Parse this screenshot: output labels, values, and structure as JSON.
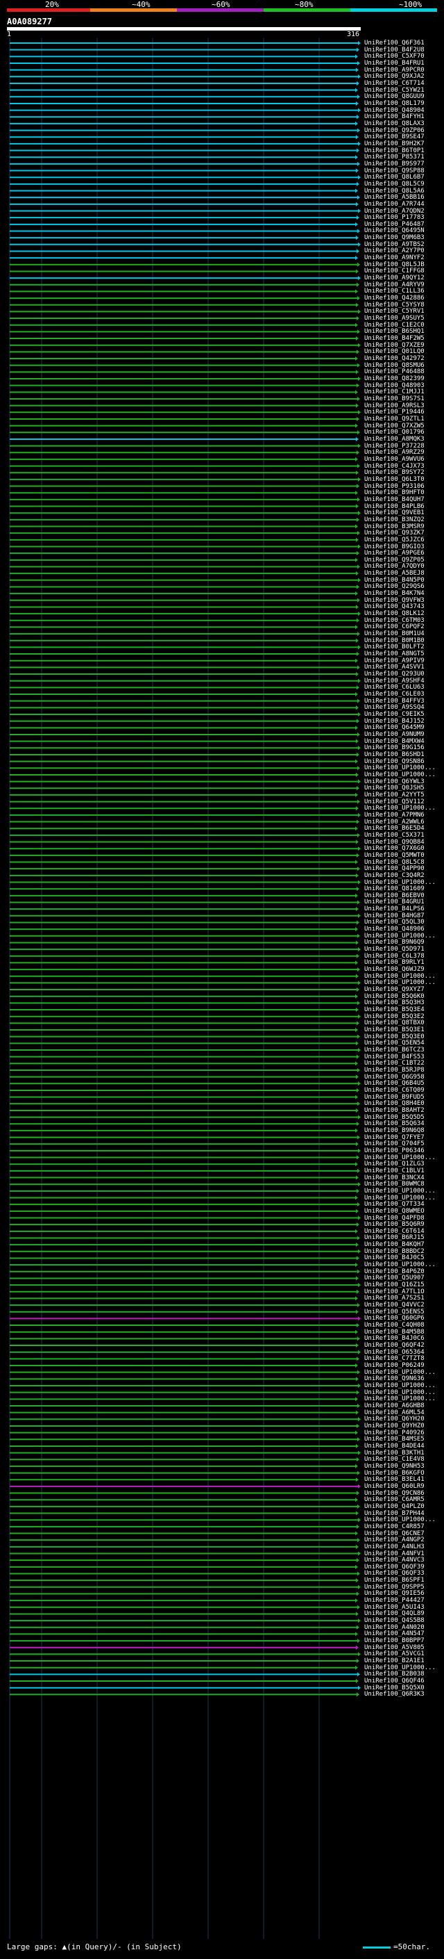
{
  "query": {
    "id": "A0A089277",
    "start": "1",
    "end": "316"
  },
  "legend": {
    "marks": [
      "20%",
      "~40%",
      "~60%",
      "~80%",
      "~100%"
    ],
    "colors": [
      "#e02020",
      "#f08020",
      "#a020c0",
      "#20c020",
      "#00d0e0"
    ]
  },
  "footer": {
    "left": "Large gaps: ▲(in Query)/- (in Subject)",
    "right": "=50char."
  },
  "hits": [
    {
      "name": "UniRef100_Q6F361",
      "c": "cyan"
    },
    {
      "name": "UniRef100_B4F2U8",
      "c": "cyan"
    },
    {
      "name": "UniRef100_C5XF70",
      "c": "cyan"
    },
    {
      "name": "UniRef100_B4FRU1",
      "c": "cyan"
    },
    {
      "name": "UniRef100_A9PCR0",
      "c": "cyan"
    },
    {
      "name": "UniRef100_Q9XJA2",
      "c": "cyan"
    },
    {
      "name": "UniRef100_C6T714",
      "c": "cyan"
    },
    {
      "name": "UniRef100_C5YW21",
      "c": "cyan"
    },
    {
      "name": "UniRef100_Q8GUU9",
      "c": "cyan"
    },
    {
      "name": "UniRef100_Q8L179",
      "c": "cyan"
    },
    {
      "name": "UniRef100_Q48904",
      "c": "cyan"
    },
    {
      "name": "UniRef100_B4FYH1",
      "c": "cyan"
    },
    {
      "name": "UniRef100_Q8LAX3",
      "c": "cyan"
    },
    {
      "name": "UniRef100_Q9ZP06",
      "c": "cyan"
    },
    {
      "name": "UniRef100_B9SE47",
      "c": "cyan"
    },
    {
      "name": "UniRef100_B9H2K7",
      "c": "cyan"
    },
    {
      "name": "UniRef100_B6T0P1",
      "c": "cyan"
    },
    {
      "name": "UniRef100_P85371",
      "c": "cyan"
    },
    {
      "name": "UniRef100_B9S977",
      "c": "cyan"
    },
    {
      "name": "UniRef100_Q9SP88",
      "c": "cyan"
    },
    {
      "name": "UniRef100_Q8L6B7",
      "c": "cyan"
    },
    {
      "name": "UniRef100_Q8L5C9",
      "c": "cyan"
    },
    {
      "name": "UniRef100_Q8L5A6",
      "c": "cyan"
    },
    {
      "name": "UniRef100_A5BB16",
      "c": "cyan"
    },
    {
      "name": "UniRef100_A7R744",
      "c": "cyan"
    },
    {
      "name": "UniRef100_A7QDN2",
      "c": "cyan"
    },
    {
      "name": "UniRef100_P17783",
      "c": "cyan"
    },
    {
      "name": "UniRef100_P46487",
      "c": "cyan"
    },
    {
      "name": "UniRef100_Q6495N",
      "c": "cyan"
    },
    {
      "name": "UniRef100_Q9M6B3",
      "c": "cyan"
    },
    {
      "name": "UniRef100_A9TBS2",
      "c": "cyan"
    },
    {
      "name": "UniRef100_A2Y7P0",
      "c": "cyan"
    },
    {
      "name": "UniRef100_A9NYF2",
      "c": "cyan"
    },
    {
      "name": "UniRef100_Q8L5JB",
      "c": "green"
    },
    {
      "name": "UniRef100_C1FFG8",
      "c": "green"
    },
    {
      "name": "UniRef100_A9QY12",
      "c": "cyan"
    },
    {
      "name": "UniRef100_A4RYV9",
      "c": "green"
    },
    {
      "name": "UniRef100_C1LL36",
      "c": "green"
    },
    {
      "name": "UniRef100_Q42886",
      "c": "green"
    },
    {
      "name": "UniRef100_C5YSY8",
      "c": "green"
    },
    {
      "name": "UniRef100_C5YRV1",
      "c": "green"
    },
    {
      "name": "UniRef100_A9SUY5",
      "c": "green"
    },
    {
      "name": "UniRef100_C1E2C0",
      "c": "green"
    },
    {
      "name": "UniRef100_B6SHQ1",
      "c": "green"
    },
    {
      "name": "UniRef100_B4F2W5",
      "c": "green"
    },
    {
      "name": "UniRef100_Q7XZE9",
      "c": "green"
    },
    {
      "name": "UniRef100_Q01LQ0",
      "c": "green"
    },
    {
      "name": "UniRef100_Q42972",
      "c": "green"
    },
    {
      "name": "UniRef100_Q8SMU6",
      "c": "green"
    },
    {
      "name": "UniRef100_P46488",
      "c": "green"
    },
    {
      "name": "UniRef100_Q82399",
      "c": "green"
    },
    {
      "name": "UniRef100_Q48903",
      "c": "green"
    },
    {
      "name": "UniRef100_C1MJJ1",
      "c": "green"
    },
    {
      "name": "UniRef100_B9S7S1",
      "c": "green"
    },
    {
      "name": "UniRef100_A9RSL3",
      "c": "green"
    },
    {
      "name": "UniRef100_P19446",
      "c": "green"
    },
    {
      "name": "UniRef100_Q9ZTL1",
      "c": "green"
    },
    {
      "name": "UniRef100_Q7XZW5",
      "c": "green"
    },
    {
      "name": "UniRef100_Q01796",
      "c": "green"
    },
    {
      "name": "UniRef100_A8MQK3",
      "c": "cyan"
    },
    {
      "name": "UniRef100_P37228",
      "c": "green"
    },
    {
      "name": "UniRef100_A9RZ29",
      "c": "green"
    },
    {
      "name": "UniRef100_A9WVU6",
      "c": "green"
    },
    {
      "name": "UniRef100_C4JX73",
      "c": "green"
    },
    {
      "name": "UniRef100_B9SY72",
      "c": "green"
    },
    {
      "name": "UniRef100_Q6L3T0",
      "c": "green"
    },
    {
      "name": "UniRef100_P93106",
      "c": "green"
    },
    {
      "name": "UniRef100_B9HFT0",
      "c": "green"
    },
    {
      "name": "UniRef100_B4QUH7",
      "c": "green"
    },
    {
      "name": "UniRef100_B4PLB6",
      "c": "green"
    },
    {
      "name": "UniRef100_Q9VEB1",
      "c": "green"
    },
    {
      "name": "UniRef100_B3NZQ2",
      "c": "green"
    },
    {
      "name": "UniRef100_B3MSR9",
      "c": "green"
    },
    {
      "name": "UniRef100_Q93ZK7",
      "c": "green"
    },
    {
      "name": "UniRef100_Q5JZC6",
      "c": "green"
    },
    {
      "name": "UniRef100_B9GIO3",
      "c": "green"
    },
    {
      "name": "UniRef100_A9PGE6",
      "c": "green"
    },
    {
      "name": "UniRef100_Q9ZP05",
      "c": "green"
    },
    {
      "name": "UniRef100_A7QDY0",
      "c": "green"
    },
    {
      "name": "UniRef100_A5BEJ8",
      "c": "green"
    },
    {
      "name": "UniRef100_B4N5P0",
      "c": "green"
    },
    {
      "name": "UniRef100_Q29QS6",
      "c": "green"
    },
    {
      "name": "UniRef100_B4K7N4",
      "c": "green"
    },
    {
      "name": "UniRef100_Q9VFW3",
      "c": "green"
    },
    {
      "name": "UniRef100_Q43743",
      "c": "green"
    },
    {
      "name": "UniRef100_Q8LK12",
      "c": "green"
    },
    {
      "name": "UniRef100_C6TM03",
      "c": "green"
    },
    {
      "name": "UniRef100_C6PQF2",
      "c": "green"
    },
    {
      "name": "UniRef100_B0M1U4",
      "c": "green"
    },
    {
      "name": "UniRef100_B0M1B0",
      "c": "green"
    },
    {
      "name": "UniRef100_B0LFT2",
      "c": "green"
    },
    {
      "name": "UniRef100_A8NGT5",
      "c": "green"
    },
    {
      "name": "UniRef100_A9PIV9",
      "c": "green"
    },
    {
      "name": "UniRef100_A4SVV1",
      "c": "green"
    },
    {
      "name": "UniRef100_Q293U0",
      "c": "green"
    },
    {
      "name": "UniRef100_A9SHF4",
      "c": "green"
    },
    {
      "name": "UniRef100_C6LU63",
      "c": "green"
    },
    {
      "name": "UniRef100_C6LE03",
      "c": "green"
    },
    {
      "name": "UniRef100_B4FFV3",
      "c": "green"
    },
    {
      "name": "UniRef100_A9SSQ4",
      "c": "green"
    },
    {
      "name": "UniRef100_C9EIK5",
      "c": "green"
    },
    {
      "name": "UniRef100_B4J152",
      "c": "green"
    },
    {
      "name": "UniRef100_Q645M9",
      "c": "green"
    },
    {
      "name": "UniRef100_A9NUM9",
      "c": "green"
    },
    {
      "name": "UniRef100_B4MXW4",
      "c": "green"
    },
    {
      "name": "UniRef100_B9G156",
      "c": "green"
    },
    {
      "name": "UniRef100_B6SHD1",
      "c": "green"
    },
    {
      "name": "UniRef100_Q9SN86",
      "c": "green"
    },
    {
      "name": "UniRef100_UP1000...",
      "c": "green"
    },
    {
      "name": "UniRef100_UP1000...",
      "c": "green"
    },
    {
      "name": "UniRef100_Q6YWL3",
      "c": "green"
    },
    {
      "name": "UniRef100_Q0JSH5",
      "c": "green"
    },
    {
      "name": "UniRef100_A2YYT5",
      "c": "green"
    },
    {
      "name": "UniRef100_Q5V112",
      "c": "green"
    },
    {
      "name": "UniRef100_UP1000...",
      "c": "green"
    },
    {
      "name": "UniRef100_A7PMN6",
      "c": "green"
    },
    {
      "name": "UniRef100_A2WWL6",
      "c": "green"
    },
    {
      "name": "UniRef100_B6E5D4",
      "c": "green"
    },
    {
      "name": "UniRef100_C5X371",
      "c": "green"
    },
    {
      "name": "UniRef100_Q9QB84",
      "c": "green"
    },
    {
      "name": "UniRef100_Q7X6G0",
      "c": "green"
    },
    {
      "name": "UniRef100_Q5MWT0",
      "c": "green"
    },
    {
      "name": "UniRef100_Q8L5C8",
      "c": "green"
    },
    {
      "name": "UniRef100_Q4PP90",
      "c": "green"
    },
    {
      "name": "UniRef100_C3Q4R2",
      "c": "green"
    },
    {
      "name": "UniRef100_UP1000...",
      "c": "green"
    },
    {
      "name": "UniRef100_Q81609",
      "c": "green"
    },
    {
      "name": "UniRef100_B6EBV0",
      "c": "green"
    },
    {
      "name": "UniRef100_B4GRU1",
      "c": "green"
    },
    {
      "name": "UniRef100_B4LPS6",
      "c": "green"
    },
    {
      "name": "UniRef100_B4HG87",
      "c": "green"
    },
    {
      "name": "UniRef100_Q5QL30",
      "c": "green"
    },
    {
      "name": "UniRef100_Q48906",
      "c": "green"
    },
    {
      "name": "UniRef100_UP1000...",
      "c": "green"
    },
    {
      "name": "UniRef100_B9N6Q9",
      "c": "green"
    },
    {
      "name": "UniRef100_Q5D971",
      "c": "green"
    },
    {
      "name": "UniRef100_C6L378",
      "c": "green"
    },
    {
      "name": "UniRef100_B9RLY1",
      "c": "green"
    },
    {
      "name": "UniRef100_Q6WJZ9",
      "c": "green"
    },
    {
      "name": "UniRef100_UP1000...",
      "c": "green"
    },
    {
      "name": "UniRef100_UP1000...",
      "c": "green"
    },
    {
      "name": "UniRef100_Q9XYZ7",
      "c": "green"
    },
    {
      "name": "UniRef100_B5Q6K0",
      "c": "green"
    },
    {
      "name": "UniRef100_B5Q3H3",
      "c": "green"
    },
    {
      "name": "UniRef100_B5Q3E4",
      "c": "green"
    },
    {
      "name": "UniRef100_B5Q3E2",
      "c": "green"
    },
    {
      "name": "UniRef100_Q8TBX0",
      "c": "green"
    },
    {
      "name": "UniRef100_B5Q3E1",
      "c": "green"
    },
    {
      "name": "UniRef100_B5Q3E0",
      "c": "green"
    },
    {
      "name": "UniRef100_Q5EN54",
      "c": "green"
    },
    {
      "name": "UniRef100_B6TCZ3",
      "c": "green"
    },
    {
      "name": "UniRef100_B4FS53",
      "c": "green"
    },
    {
      "name": "UniRef100_C1BT22",
      "c": "green"
    },
    {
      "name": "UniRef100_B5RJP8",
      "c": "green"
    },
    {
      "name": "UniRef100_Q6G958",
      "c": "green"
    },
    {
      "name": "UniRef100_Q6B4U5",
      "c": "green"
    },
    {
      "name": "UniRef100_C6TQ09",
      "c": "green"
    },
    {
      "name": "UniRef100_B9FUD5",
      "c": "green"
    },
    {
      "name": "UniRef100_Q8H4E0",
      "c": "green"
    },
    {
      "name": "UniRef100_B8AHT2",
      "c": "green"
    },
    {
      "name": "UniRef100_B5Q5D5",
      "c": "green"
    },
    {
      "name": "UniRef100_B5Q634",
      "c": "green"
    },
    {
      "name": "UniRef100_B9N6Q8",
      "c": "green"
    },
    {
      "name": "UniRef100_Q7FYE7",
      "c": "green"
    },
    {
      "name": "UniRef100_Q704F5",
      "c": "green"
    },
    {
      "name": "UniRef100_P06346",
      "c": "green"
    },
    {
      "name": "UniRef100_UP1000...",
      "c": "green"
    },
    {
      "name": "UniRef100_Q1ZLG3",
      "c": "green"
    },
    {
      "name": "UniRef100_C1BLV1",
      "c": "green"
    },
    {
      "name": "UniRef100_B3NCX4",
      "c": "green"
    },
    {
      "name": "UniRef100_B0WMC8",
      "c": "green"
    },
    {
      "name": "UniRef100_UP1000...",
      "c": "green"
    },
    {
      "name": "UniRef100_UP1000...",
      "c": "green"
    },
    {
      "name": "UniRef100_Q7T334",
      "c": "green"
    },
    {
      "name": "UniRef100_Q8WMEO",
      "c": "green"
    },
    {
      "name": "UniRef100_Q4PFD8",
      "c": "green"
    },
    {
      "name": "UniRef100_B5Q6R9",
      "c": "green"
    },
    {
      "name": "UniRef100_C6T614",
      "c": "green"
    },
    {
      "name": "UniRef100_B6RJ15",
      "c": "green"
    },
    {
      "name": "UniRef100_B4KQH7",
      "c": "green"
    },
    {
      "name": "UniRef100_B8BDC2",
      "c": "green"
    },
    {
      "name": "UniRef100_B4J0C5",
      "c": "green"
    },
    {
      "name": "UniRef100_UP1000...",
      "c": "green"
    },
    {
      "name": "UniRef100_B4P6Z0",
      "c": "green"
    },
    {
      "name": "UniRef100_Q5U907",
      "c": "green"
    },
    {
      "name": "UniRef100_Q16Z15",
      "c": "green"
    },
    {
      "name": "UniRef100_A7TL1O",
      "c": "green"
    },
    {
      "name": "UniRef100_A7S2S1",
      "c": "green"
    },
    {
      "name": "UniRef100_Q4VVC2",
      "c": "green"
    },
    {
      "name": "UniRef100_Q5ENS5",
      "c": "green"
    },
    {
      "name": "UniRef100_Q60GP6",
      "c": "magenta"
    },
    {
      "name": "UniRef100_C4QH08",
      "c": "green"
    },
    {
      "name": "UniRef100_B4M5B8",
      "c": "green"
    },
    {
      "name": "UniRef100_B4J0C6",
      "c": "green"
    },
    {
      "name": "UniRef100_Q6QF42",
      "c": "green"
    },
    {
      "name": "UniRef100_O65364",
      "c": "green"
    },
    {
      "name": "UniRef100_C7TZT8",
      "c": "green"
    },
    {
      "name": "UniRef100_P06249",
      "c": "green"
    },
    {
      "name": "UniRef100_UP1000...",
      "c": "green"
    },
    {
      "name": "UniRef100_Q9N636",
      "c": "green"
    },
    {
      "name": "UniRef100_UP1000...",
      "c": "green"
    },
    {
      "name": "UniRef100_UP1000...",
      "c": "green"
    },
    {
      "name": "UniRef100_UP1000...",
      "c": "green"
    },
    {
      "name": "UniRef100_A6GHB8",
      "c": "green"
    },
    {
      "name": "UniRef100_A6ML54",
      "c": "green"
    },
    {
      "name": "UniRef100_Q6YH20",
      "c": "green"
    },
    {
      "name": "UniRef100_Q9YHZ0",
      "c": "green"
    },
    {
      "name": "UniRef100_P40926",
      "c": "green"
    },
    {
      "name": "UniRef100_B4MSE5",
      "c": "green"
    },
    {
      "name": "UniRef100_B4DE44",
      "c": "green"
    },
    {
      "name": "UniRef100_B3KTH1",
      "c": "green"
    },
    {
      "name": "UniRef100_C1E4V8",
      "c": "green"
    },
    {
      "name": "UniRef100_Q9NH53",
      "c": "green"
    },
    {
      "name": "UniRef100_B6KGFO",
      "c": "green"
    },
    {
      "name": "UniRef100_B3EL41",
      "c": "green"
    },
    {
      "name": "UniRef100_Q60LR9",
      "c": "magenta"
    },
    {
      "name": "UniRef100_Q9CN86",
      "c": "green"
    },
    {
      "name": "UniRef100_C6AMR5",
      "c": "green"
    },
    {
      "name": "UniRef100_Q4PLZ0",
      "c": "green"
    },
    {
      "name": "UniRef100_B7PH44",
      "c": "green"
    },
    {
      "name": "UniRef100_UP1000...",
      "c": "green"
    },
    {
      "name": "UniRef100_C4R857",
      "c": "green"
    },
    {
      "name": "UniRef100_Q6CNE7",
      "c": "green"
    },
    {
      "name": "UniRef100_A4NGP2",
      "c": "green"
    },
    {
      "name": "UniRef100_A4NLH3",
      "c": "green"
    },
    {
      "name": "UniRef100_A4NFV1",
      "c": "green"
    },
    {
      "name": "UniRef100_A4NVC3",
      "c": "green"
    },
    {
      "name": "UniRef100_Q6QF39",
      "c": "green"
    },
    {
      "name": "UniRef100_Q6QF33",
      "c": "green"
    },
    {
      "name": "UniRef100_B6SPF1",
      "c": "green"
    },
    {
      "name": "UniRef100_Q9SPP5",
      "c": "green"
    },
    {
      "name": "UniRef100_Q9IE56",
      "c": "green"
    },
    {
      "name": "UniRef100_P44427",
      "c": "green"
    },
    {
      "name": "UniRef100_A5UI43",
      "c": "green"
    },
    {
      "name": "UniRef100_Q4QL89",
      "c": "green"
    },
    {
      "name": "UniRef100_Q4S5B8",
      "c": "green"
    },
    {
      "name": "UniRef100_A4N020",
      "c": "green"
    },
    {
      "name": "UniRef100_A4N547",
      "c": "green"
    },
    {
      "name": "UniRef100_B0BPP7",
      "c": "green"
    },
    {
      "name": "UniRef100_A5V805",
      "c": "magenta"
    },
    {
      "name": "UniRef100_A5VCG1",
      "c": "green"
    },
    {
      "name": "UniRef100_B2A1E1",
      "c": "green"
    },
    {
      "name": "UniRef100_UP1000...",
      "c": "green"
    },
    {
      "name": "UniRef100_B2B038",
      "c": "cyan"
    },
    {
      "name": "UniRef100_Q6QF46",
      "c": "green"
    },
    {
      "name": "UniRef100_B5Q5X0",
      "c": "cyan"
    },
    {
      "name": "UniRef100_Q6R3K3",
      "c": "green"
    }
  ]
}
